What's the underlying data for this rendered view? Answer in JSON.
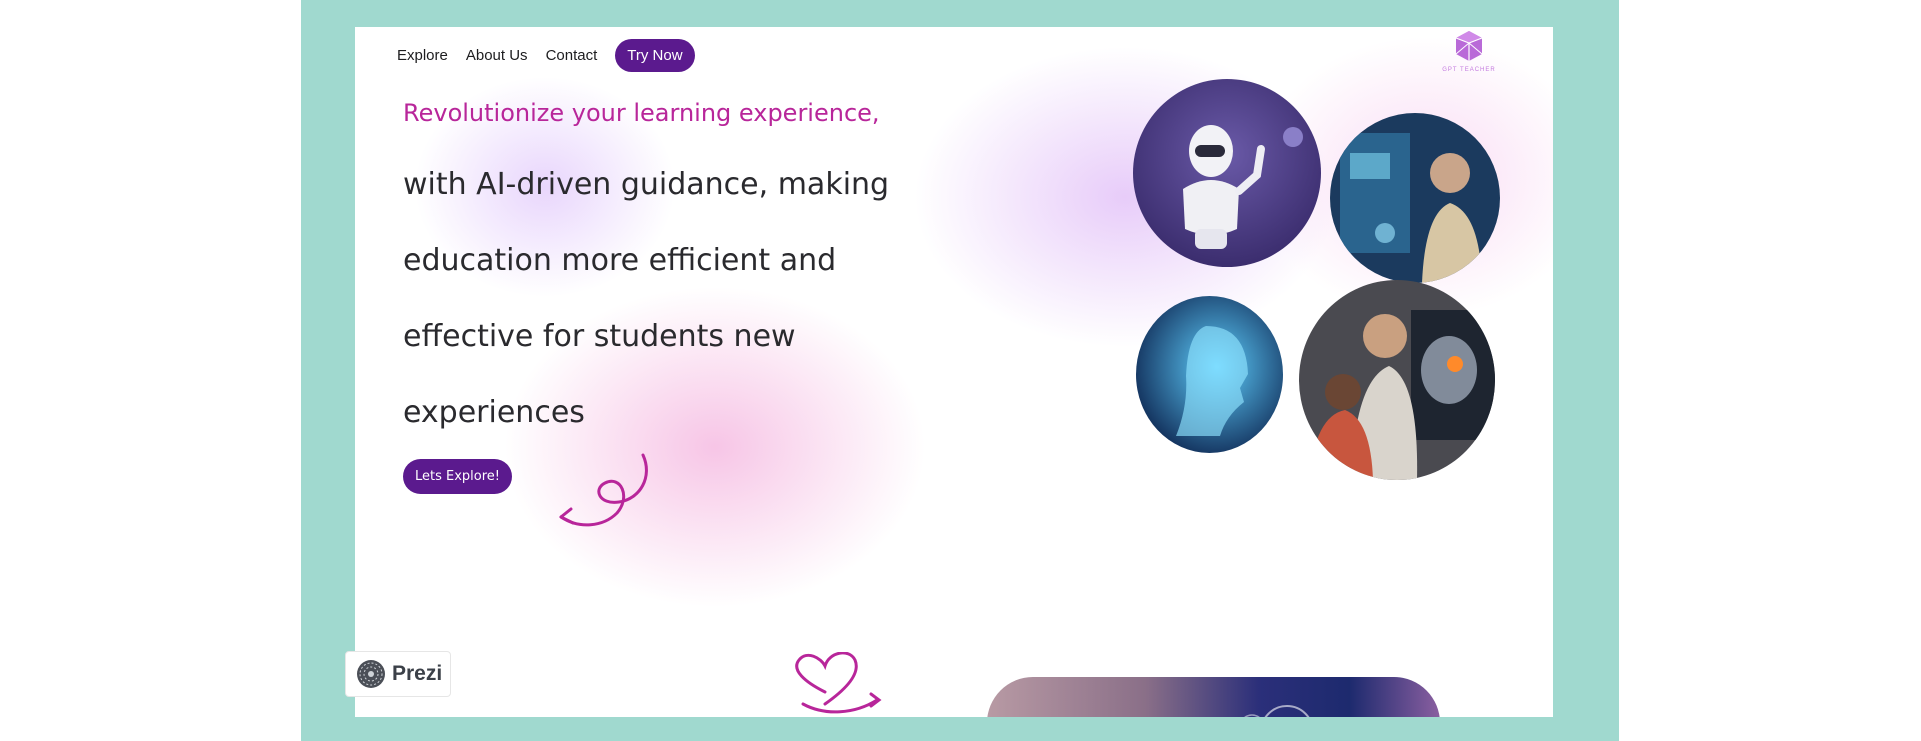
{
  "nav": {
    "items": [
      {
        "label": "Explore"
      },
      {
        "label": "About Us"
      },
      {
        "label": "Contact"
      }
    ],
    "cta_label": "Try Now",
    "logo_text": "GPT TEACHER"
  },
  "hero": {
    "tagline": "Revolutionize your learning experience,",
    "body": "with AI-driven guidance, making education more efficient and effective for students new experiences",
    "button_label": "Lets Explore!"
  },
  "badge": {
    "label": "Prezi"
  },
  "colors": {
    "frame_bg": "#a0d9cf",
    "accent_purple": "#5b1a8e",
    "tagline_magenta": "#b8269a"
  },
  "icons": [
    "logo-polyhedron-icon",
    "swirl-arrow-icon",
    "heart-doodle-icon",
    "prezi-logo-icon"
  ]
}
